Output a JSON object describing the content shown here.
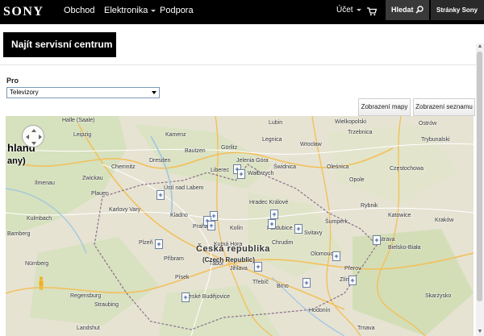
{
  "header": {
    "logo": "SONY",
    "nav": [
      "Obchod",
      "Elektronika",
      "Podpora"
    ],
    "account": "Účet",
    "cart_icon": "cart-icon",
    "search_label": "Hledat",
    "sites_label": "Stránky Sony"
  },
  "page": {
    "title": "Najít servisní centrum",
    "filter_label": "Pro",
    "filter_value": "Televizory",
    "map_view_button": "Zobrazení mapy",
    "list_view_button": "Zobrazení seznamu"
  },
  "map": {
    "country_label": "Česká republika",
    "country_sub": "(Czech Republic)",
    "left_overlay_top": "hland",
    "left_overlay_bottom": "any)",
    "cities": [
      {
        "name": "Halle (Saale)"
      },
      {
        "name": "Leipzig"
      },
      {
        "name": "Kamenz"
      },
      {
        "name": "Lubin"
      },
      {
        "name": "Wielkopolski"
      },
      {
        "name": "Ostrów"
      },
      {
        "name": "Dresden"
      },
      {
        "name": "Bautzen"
      },
      {
        "name": "Görlitz"
      },
      {
        "name": "Legnica"
      },
      {
        "name": "Wrocław"
      },
      {
        "name": "Trzebnica"
      },
      {
        "name": "Chemnitz"
      },
      {
        "name": "Zwickau"
      },
      {
        "name": "Jelenia Góra"
      },
      {
        "name": "Świdnica"
      },
      {
        "name": "Oleśnica"
      },
      {
        "name": "Częstochowa"
      },
      {
        "name": "Ilmenau"
      },
      {
        "name": "Liberec"
      },
      {
        "name": "Wałbrzych"
      },
      {
        "name": "Opole"
      },
      {
        "name": "Plauen"
      },
      {
        "name": "Ústí nad Labem"
      },
      {
        "name": "Hradec Králové"
      },
      {
        "name": "Katowice"
      },
      {
        "name": "Karlovy Vary"
      },
      {
        "name": "Kladno"
      },
      {
        "name": "Pardubice"
      },
      {
        "name": "Kraków"
      },
      {
        "name": "Kulmbach"
      },
      {
        "name": "Praha"
      },
      {
        "name": "Kolín"
      },
      {
        "name": "Rybnik"
      },
      {
        "name": "Bamberg"
      },
      {
        "name": "Plzeň"
      },
      {
        "name": "Ostrava"
      },
      {
        "name": "Nürnberg"
      },
      {
        "name": "Příbram"
      },
      {
        "name": "Olomouc"
      },
      {
        "name": "Bielsko-Biała"
      },
      {
        "name": "Jihlava"
      },
      {
        "name": "Zlín"
      },
      {
        "name": "Regensburg"
      },
      {
        "name": "Písek"
      },
      {
        "name": "Třebíč"
      },
      {
        "name": "Brno"
      },
      {
        "name": "České Budějovice"
      },
      {
        "name": "Straubing"
      },
      {
        "name": "Landshut"
      },
      {
        "name": "Hodonín"
      },
      {
        "name": "Trnava"
      },
      {
        "name": "Trybunalski"
      },
      {
        "name": "Skarżysko"
      },
      {
        "name": "Přerov"
      },
      {
        "name": "Kutná Hora"
      },
      {
        "name": "Chrudim"
      },
      {
        "name": "Svitavy"
      },
      {
        "name": "Šumperk"
      },
      {
        "name": "Tábor"
      }
    ]
  }
}
